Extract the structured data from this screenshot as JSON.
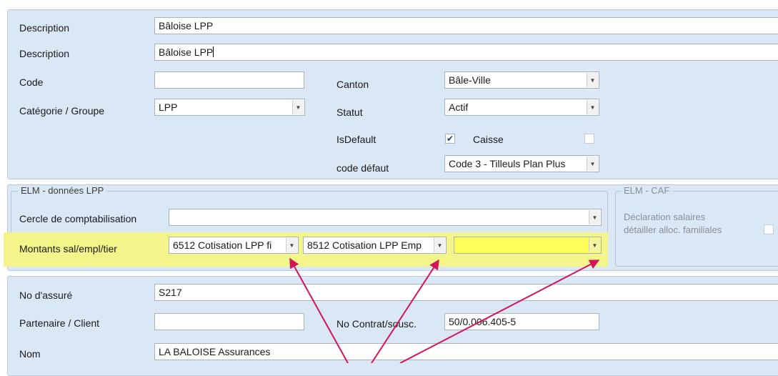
{
  "top": {
    "description_label": "Description",
    "description_value": "Bâloise LPP",
    "description2_label": "Description",
    "description2_value": "Bâloise LPP",
    "code_label": "Code",
    "code_value": "",
    "canton_label": "Canton",
    "canton_value": "Bâle-Ville",
    "categorie_label": "Catégorie / Groupe",
    "categorie_value": "LPP",
    "statut_label": "Statut",
    "statut_value": "Actif",
    "isdefault_label": "IsDefault",
    "isdefault_checked": "✔",
    "caisse_label": "Caisse",
    "code_defaut_label": "code défaut",
    "code_defaut_value": "Code 3 - Tilleuls Plan Plus"
  },
  "elm_lpp": {
    "title": "ELM - données LPP",
    "cercle_label": "Cercle de comptabilisation",
    "cercle_value": "",
    "montants_label": "Montants sal/empl/tier",
    "montant_sal": "6512 Cotisation LPP fi",
    "montant_empl": "8512 Cotisation LPP Emp",
    "montant_tier": ""
  },
  "elm_caf": {
    "title": "ELM - CAF",
    "declaration_label_1": "Déclaration salaires",
    "declaration_label_2": "détailler alloc. familiales"
  },
  "bottom": {
    "no_assure_label": "No d'assuré",
    "no_assure_value": "S217",
    "partenaire_label": "Partenaire / Client",
    "partenaire_value": "",
    "no_contrat_label": "No Contrat/sousc.",
    "no_contrat_value": "50/0.006.405-5",
    "nom_label": "Nom",
    "nom_value": "LA BALOISE Assurances"
  },
  "colors": {
    "panel": "#dae7f5",
    "highlight": "#f3f58a",
    "arrow": "#d4145a"
  }
}
